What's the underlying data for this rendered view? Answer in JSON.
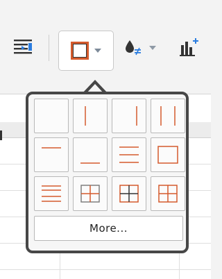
{
  "toolbar": {
    "buttons": [
      {
        "id": "wrap-text",
        "icon": "wrap-text-icon"
      },
      {
        "id": "borders",
        "icon": "border-all-icon",
        "dropdown": true
      },
      {
        "id": "conditional-fill",
        "icon": "conditional-fill-icon",
        "dropdown": true
      },
      {
        "id": "insert-chart",
        "icon": "insert-chart-icon"
      }
    ]
  },
  "borders_menu": {
    "options": [
      "border-none",
      "border-left",
      "border-right",
      "border-left-right",
      "border-top",
      "border-bottom",
      "border-top-bottom",
      "border-outer",
      "border-horizontal-inner",
      "border-all-inner",
      "border-all-mixed",
      "border-all"
    ],
    "more_label": "More..."
  },
  "colors": {
    "accent": "#d45a2c",
    "icon_dark": "#333333",
    "icon_blue": "#2b7de0"
  }
}
